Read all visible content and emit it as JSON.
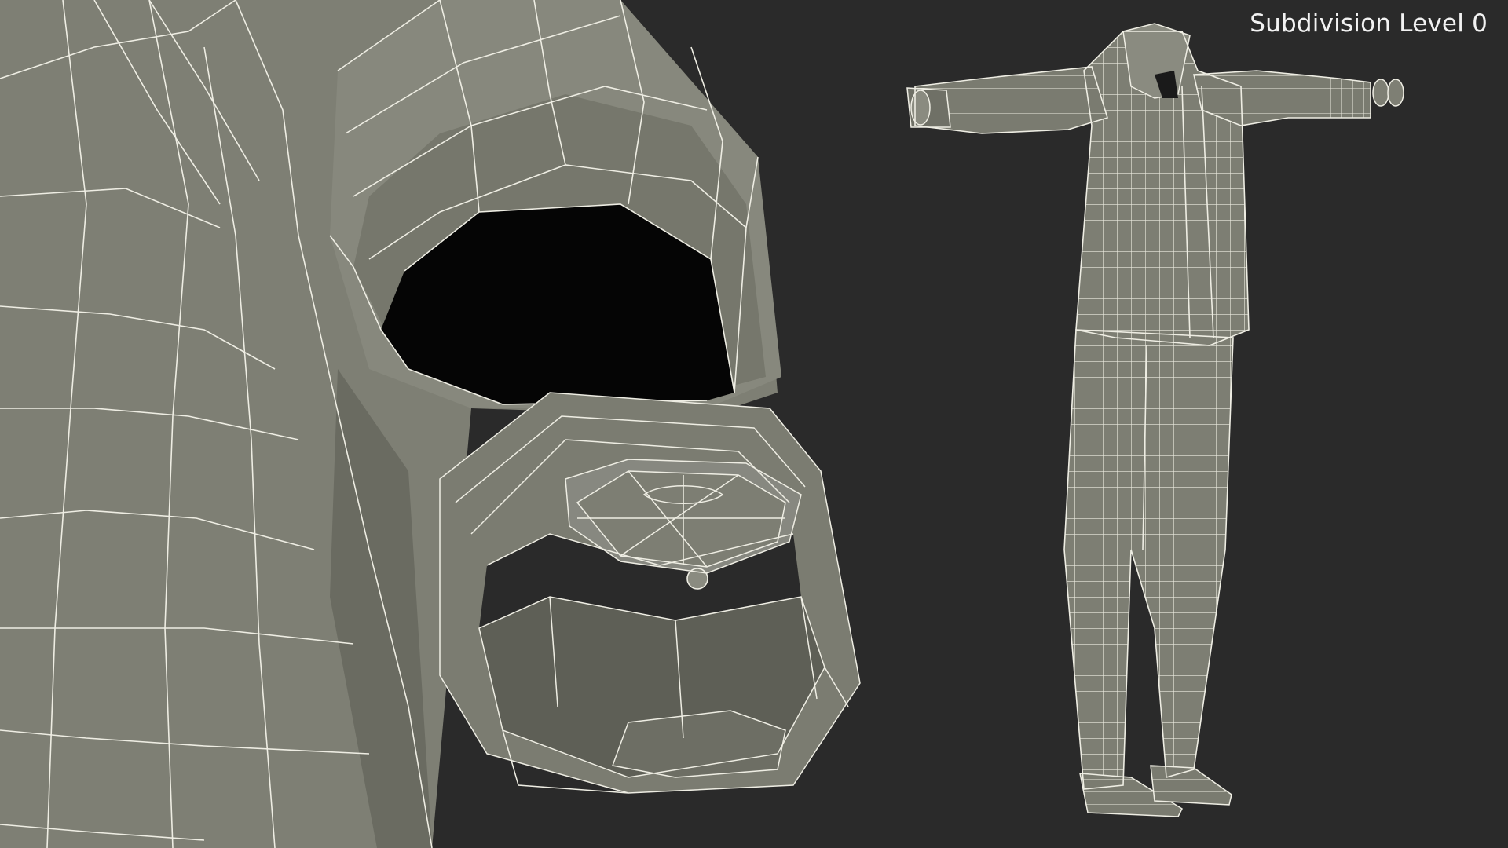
{
  "viewport_label": "Subdivision Level 0",
  "colors": {
    "background": "#2a2a2a",
    "mesh_surface": "#7c7d72",
    "mesh_surface_light": "#8c8d82",
    "mesh_surface_dark": "#5f6057",
    "wireframe": "#efeee4",
    "cavity": "#050505",
    "label_text": "#f2f2f2"
  },
  "objects": [
    {
      "name": "shoulder-sleeve-closeup-mesh"
    },
    {
      "name": "wristwatch-closeup-mesh"
    },
    {
      "name": "suit-tpose-mesh"
    }
  ]
}
